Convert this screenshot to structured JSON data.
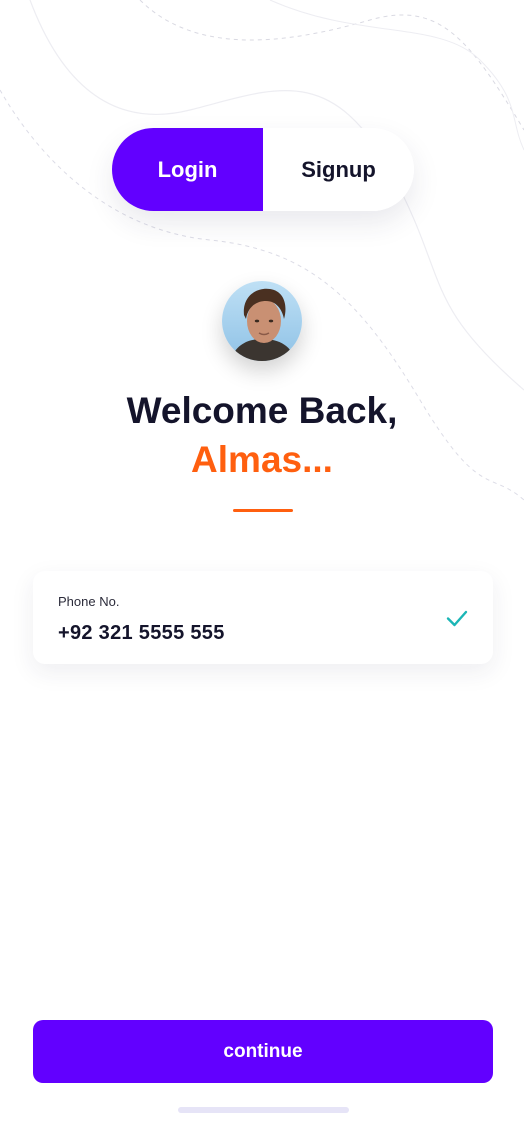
{
  "auth_toggle": {
    "login_label": "Login",
    "signup_label": "Signup",
    "active": "login"
  },
  "greeting": {
    "line1": "Welcome Back,",
    "name": "Almas..."
  },
  "phone": {
    "label": "Phone No.",
    "value": "+92 321 5555 555",
    "verified": true
  },
  "actions": {
    "continue_label": "continue"
  },
  "colors": {
    "primary": "#6200ff",
    "accent": "#ff5f0f",
    "text_dark": "#14142b",
    "check": "#1bb6b6"
  },
  "icons": {
    "verified": "check-icon",
    "avatar": "user-avatar"
  }
}
